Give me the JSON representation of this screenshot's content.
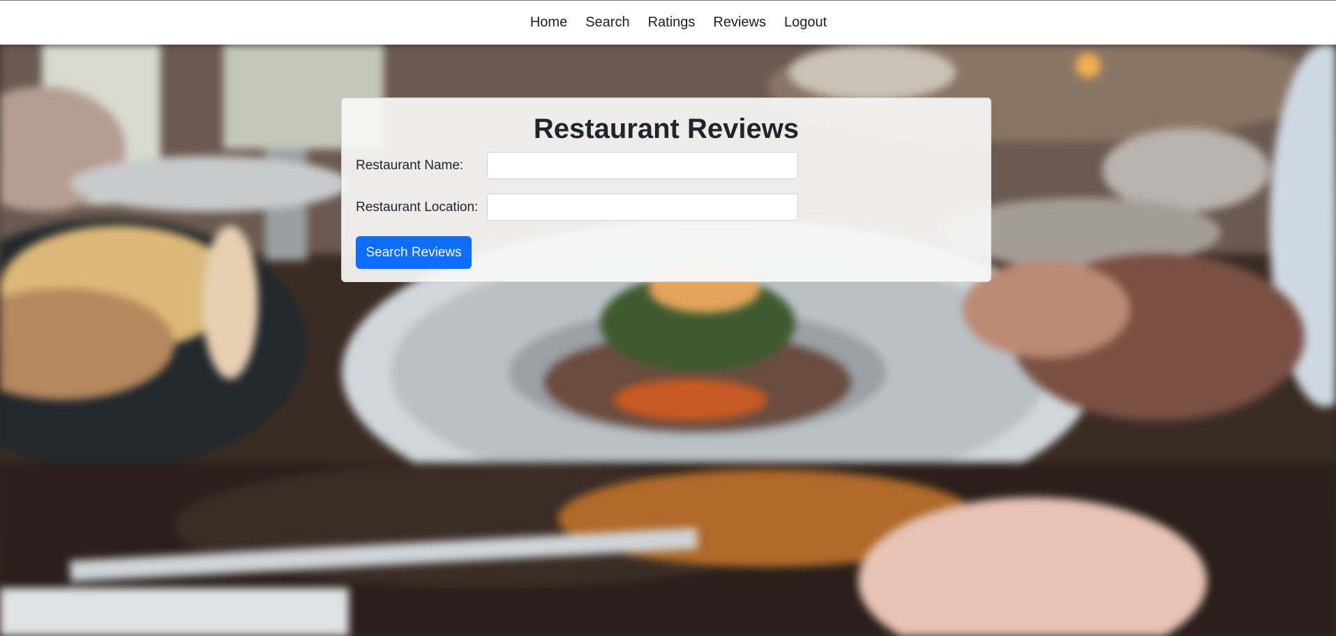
{
  "nav": {
    "items": [
      {
        "label": "Home"
      },
      {
        "label": "Search"
      },
      {
        "label": "Ratings"
      },
      {
        "label": "Reviews"
      },
      {
        "label": "Logout"
      }
    ]
  },
  "card": {
    "title": "Restaurant Reviews",
    "name_label": "Restaurant Name:",
    "name_value": "",
    "location_label": "Restaurant Location:",
    "location_value": "",
    "search_button": "Search Reviews"
  },
  "colors": {
    "primary": "#0d6efd",
    "nav_bg": "#ffffff",
    "card_bg": "#f8f8f8",
    "text": "#212529"
  }
}
